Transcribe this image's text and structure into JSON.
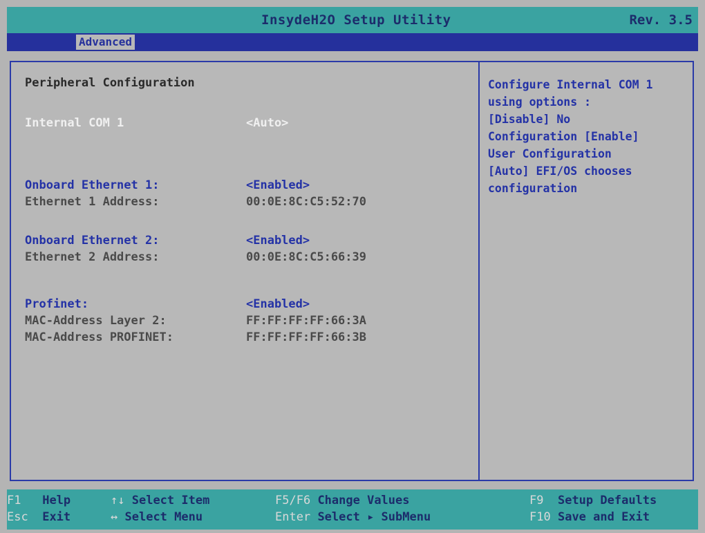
{
  "header": {
    "title": "InsydeH2O Setup Utility",
    "revision": "Rev. 3.5"
  },
  "menu": {
    "active_tab": "Advanced"
  },
  "main": {
    "section_title": "Peripheral Configuration",
    "items": [
      {
        "label": "Internal COM 1",
        "value": "<Auto>"
      },
      {
        "label": "Onboard Ethernet 1:",
        "value": "<Enabled>"
      },
      {
        "label": "Ethernet 1 Address:",
        "value": "00:0E:8C:C5:52:70"
      },
      {
        "label": "Onboard Ethernet 2:",
        "value": "<Enabled>"
      },
      {
        "label": "Ethernet 2 Address:",
        "value": "00:0E:8C:C5:66:39"
      },
      {
        "label": "Profinet:",
        "value": "<Enabled>"
      },
      {
        "label": "MAC-Address Layer 2:",
        "value": "FF:FF:FF:FF:66:3A"
      },
      {
        "label": "MAC-Address PROFINET:",
        "value": "FF:FF:FF:FF:66:3B"
      }
    ]
  },
  "help": {
    "lines": [
      "Configure Internal COM 1",
      "using options :",
      "[Disable] No",
      "Configuration [Enable]",
      "User Configuration",
      "[Auto] EFI/OS chooses",
      "configuration"
    ]
  },
  "footer": {
    "keys": [
      {
        "key": "F1",
        "desc": "Help"
      },
      {
        "key": "Esc",
        "desc": "Exit"
      },
      {
        "key": "↑↓",
        "desc": "Select Item"
      },
      {
        "key": "↔",
        "desc": "Select Menu"
      },
      {
        "key": "F5/F6",
        "desc": "Change Values"
      },
      {
        "key": "Enter",
        "desc": "Select ▸ SubMenu"
      },
      {
        "key": "F9",
        "desc": "Setup Defaults"
      },
      {
        "key": "F10",
        "desc": "Save and Exit"
      }
    ]
  },
  "colors": {
    "title_bar": "#3aa3a1",
    "menu_bar": "#25309c",
    "panel": "#b8b8b8",
    "highlight_text": "#2432a6"
  }
}
